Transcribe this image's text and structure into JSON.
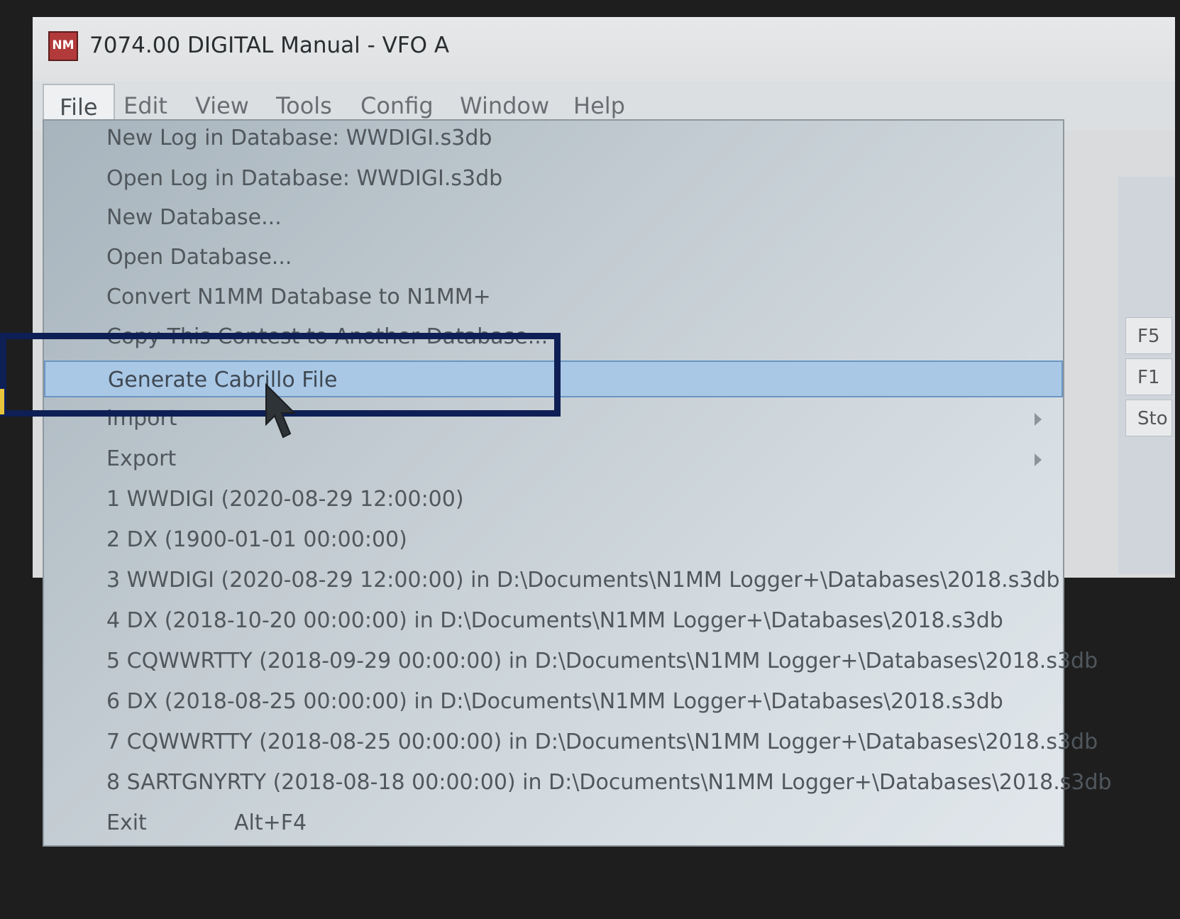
{
  "window": {
    "app_icon_text": "NM",
    "title": "7074.00 DIGITAL Manual - VFO A"
  },
  "menu_bar": [
    {
      "label": "File",
      "active": true
    },
    {
      "label": "Edit"
    },
    {
      "label": "View"
    },
    {
      "label": "Tools"
    },
    {
      "label": "Config"
    },
    {
      "label": "Window"
    },
    {
      "label": "Help"
    }
  ],
  "side_buttons": [
    "F5",
    "F1",
    "Sto"
  ],
  "file_menu": {
    "items": [
      {
        "label": "New Log in Database: WWDIGI.s3db"
      },
      {
        "label": "Open Log in Database: WWDIGI.s3db"
      },
      {
        "label": "New Database..."
      },
      {
        "label": "Open Database..."
      },
      {
        "label": "Convert N1MM Database to N1MM+"
      },
      {
        "label": "Copy This Contest to Another Database..."
      },
      {
        "label": "Generate Cabrillo File",
        "highlighted": true
      },
      {
        "label": "Import",
        "submenu": true
      },
      {
        "label": "Export",
        "submenu": true
      },
      {
        "label": "1 WWDIGI (2020-08-29 12:00:00)"
      },
      {
        "label": "2 DX (1900-01-01 00:00:00)"
      },
      {
        "label": "3 WWDIGI (2020-08-29 12:00:00) in D:\\Documents\\N1MM Logger+\\Databases\\2018.s3db"
      },
      {
        "label": "4 DX (2018-10-20 00:00:00) in D:\\Documents\\N1MM Logger+\\Databases\\2018.s3db"
      },
      {
        "label": "5 CQWWRTTY (2018-09-29 00:00:00) in D:\\Documents\\N1MM Logger+\\Databases\\2018.s3db"
      },
      {
        "label": "6 DX (2018-08-25 00:00:00) in D:\\Documents\\N1MM Logger+\\Databases\\2018.s3db"
      },
      {
        "label": "7 CQWWRTTY (2018-08-25 00:00:00) in D:\\Documents\\N1MM Logger+\\Databases\\2018.s3db"
      },
      {
        "label": "8 SARTGNYRTY (2018-08-18 00:00:00) in D:\\Documents\\N1MM Logger+\\Databases\\2018.s3db"
      },
      {
        "label": "Exit",
        "shortcut": "Alt+F4"
      }
    ]
  },
  "colors": {
    "highlight": "#a9c8e6",
    "annotation_box": "#0e1f55"
  }
}
